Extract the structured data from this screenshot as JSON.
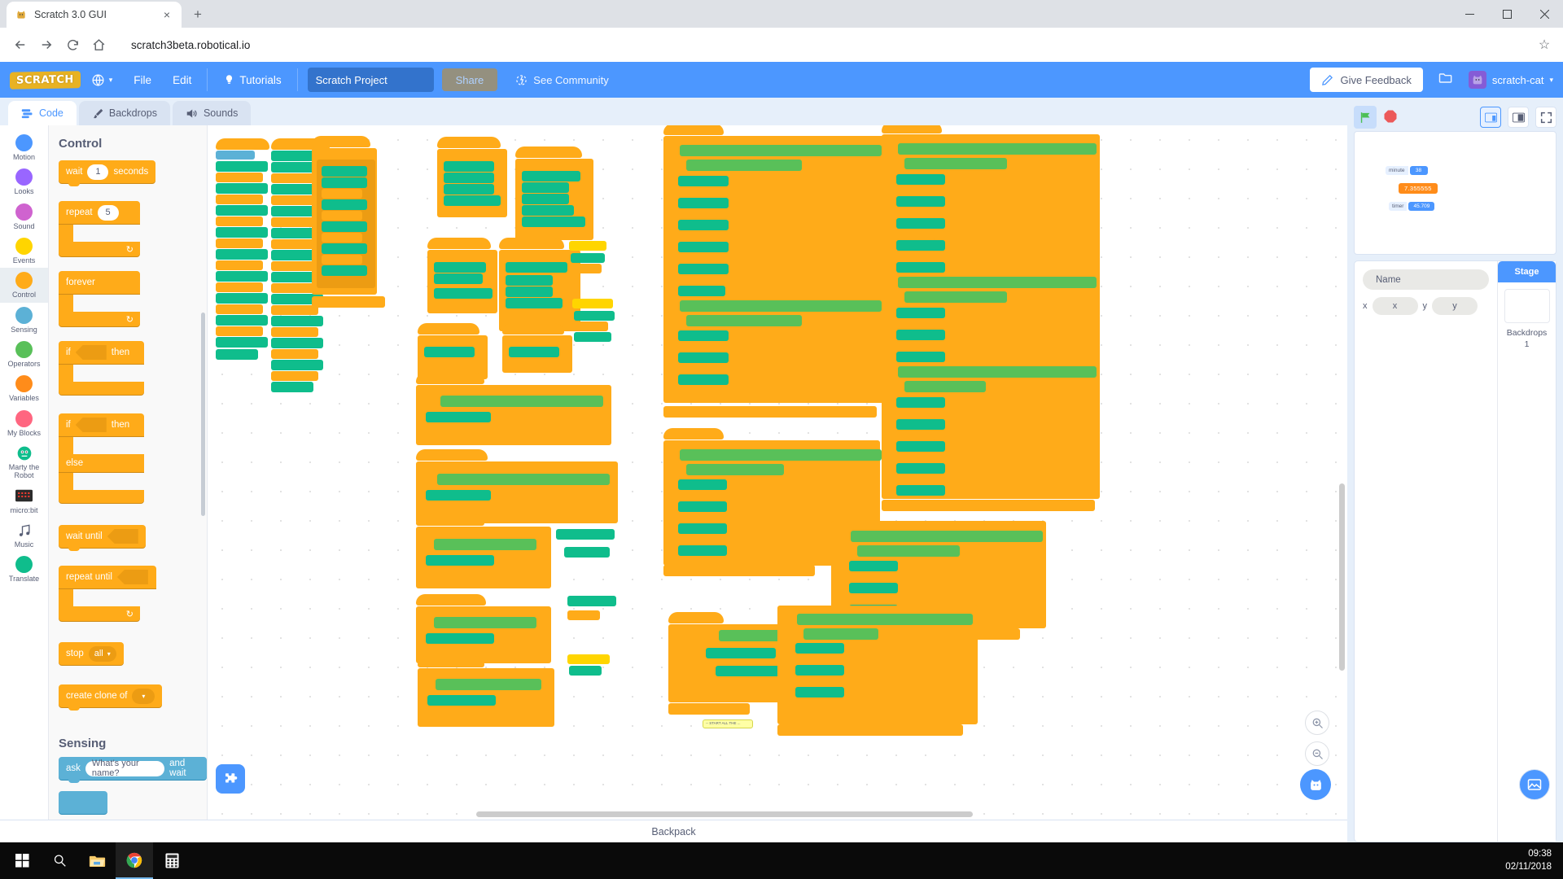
{
  "browser": {
    "tab": {
      "title": "Scratch 3.0 GUI",
      "favicon": "scratch-cat-favicon",
      "close": "×"
    },
    "newtab_label": "+",
    "window_controls": {
      "minimize": "—",
      "maximize": "□",
      "close": "✕"
    },
    "nav": {
      "back": "←",
      "forward": "→",
      "reload": "⟳",
      "home": "⌂"
    },
    "url": "scratch3beta.robotical.io",
    "bookmark_star": "☆"
  },
  "menubar": {
    "logo": "SCRATCH",
    "language_icon": "globe-icon",
    "file_label": "File",
    "edit_label": "Edit",
    "tutorials_label": "Tutorials",
    "project_name": "Scratch Project",
    "share_label": "Share",
    "see_community_label": "See Community",
    "feedback_label": "Give Feedback",
    "folder_icon": "folder-icon",
    "account_name": "scratch-cat",
    "account_caret": "▾"
  },
  "tabs": [
    {
      "label": "Code",
      "icon": "code-icon",
      "active": true
    },
    {
      "label": "Backdrops",
      "icon": "paintbrush-icon",
      "active": false
    },
    {
      "label": "Sounds",
      "icon": "speaker-icon",
      "active": false
    }
  ],
  "categories": [
    {
      "label": "Motion",
      "color": "#4c97ff",
      "type": "dot",
      "active": false
    },
    {
      "label": "Looks",
      "color": "#9966ff",
      "type": "dot",
      "active": false
    },
    {
      "label": "Sound",
      "color": "#cf63cf",
      "type": "dot",
      "active": false
    },
    {
      "label": "Events",
      "color": "#ffd500",
      "type": "dot",
      "active": false
    },
    {
      "label": "Control",
      "color": "#ffab19",
      "type": "dot",
      "active": true
    },
    {
      "label": "Sensing",
      "color": "#5cb1d6",
      "type": "dot",
      "active": false
    },
    {
      "label": "Operators",
      "color": "#59c059",
      "type": "dot",
      "active": false
    },
    {
      "label": "Variables",
      "color": "#ff8c1a",
      "type": "dot",
      "active": false
    },
    {
      "label": "My Blocks",
      "color": "#ff6680",
      "type": "dot",
      "active": false
    },
    {
      "label": "Marty the Robot",
      "color": "#0fbd8c",
      "type": "icon",
      "glyph": "🤖",
      "active": false
    },
    {
      "label": "micro:bit",
      "color": "#5b5b5b",
      "type": "icon",
      "glyph": "▦",
      "active": false
    },
    {
      "label": "Music",
      "color": "#575e75",
      "type": "icon",
      "glyph": "♫",
      "active": false
    },
    {
      "label": "Translate",
      "color": "#0fbd8c",
      "type": "dot",
      "active": false
    }
  ],
  "palette": {
    "section_control": "Control",
    "section_sensing": "Sensing",
    "blocks": {
      "wait_pre": "wait",
      "wait_val": "1",
      "wait_post": "seconds",
      "repeat_pre": "repeat",
      "repeat_val": "5",
      "forever": "forever",
      "if_pre": "if",
      "if_post": "then",
      "ifelse_pre": "if",
      "ifelse_post": "then",
      "else": "else",
      "wait_until": "wait until",
      "repeat_until": "repeat until",
      "stop_pre": "stop",
      "stop_opt": "all",
      "stop_caret": "▾",
      "create_clone_pre": "create clone of",
      "clone_caret": "▾",
      "ask_pre": "ask",
      "ask_val": "What's your name?",
      "ask_post": "and wait"
    }
  },
  "workspace": {
    "comment_text": "-- START ALL THE ...",
    "zoom_in": "zoom-in",
    "zoom_out": "zoom-out",
    "zoom_reset": "zoom-reset",
    "zoom_in_glyph": "＋",
    "zoom_out_glyph": "－",
    "zoom_reset_glyph": "＝",
    "add_extension": "+"
  },
  "backpack": {
    "label": "Backpack"
  },
  "stage": {
    "green_flag": "green-flag",
    "stop": "stop-sign",
    "layout_small": "small-stage-layout",
    "layout_large": "large-stage-layout",
    "fullscreen": "fullscreen",
    "monitors": [
      {
        "label": "minute",
        "value": "38",
        "style": "normal"
      },
      {
        "label": "7.355555",
        "value": "",
        "style": "large"
      },
      {
        "label": "timer",
        "value": "45.709",
        "style": "normal"
      }
    ]
  },
  "sprite_panel": {
    "name_placeholder": "Name",
    "x_label": "x",
    "x_value": "x",
    "y_label": "y",
    "y_value": "y",
    "stage_header": "Stage",
    "backdrops_label": "Backdrops",
    "backdrops_count": "1",
    "add_sprite": "＋",
    "add_backdrop": "＋"
  },
  "taskbar": {
    "start": "start-button",
    "search": "search-icon",
    "explorer": "file-explorer-icon",
    "chrome": "chrome-icon",
    "calculator": "calculator-icon",
    "time": "09:38",
    "date": "02/11/2018"
  }
}
